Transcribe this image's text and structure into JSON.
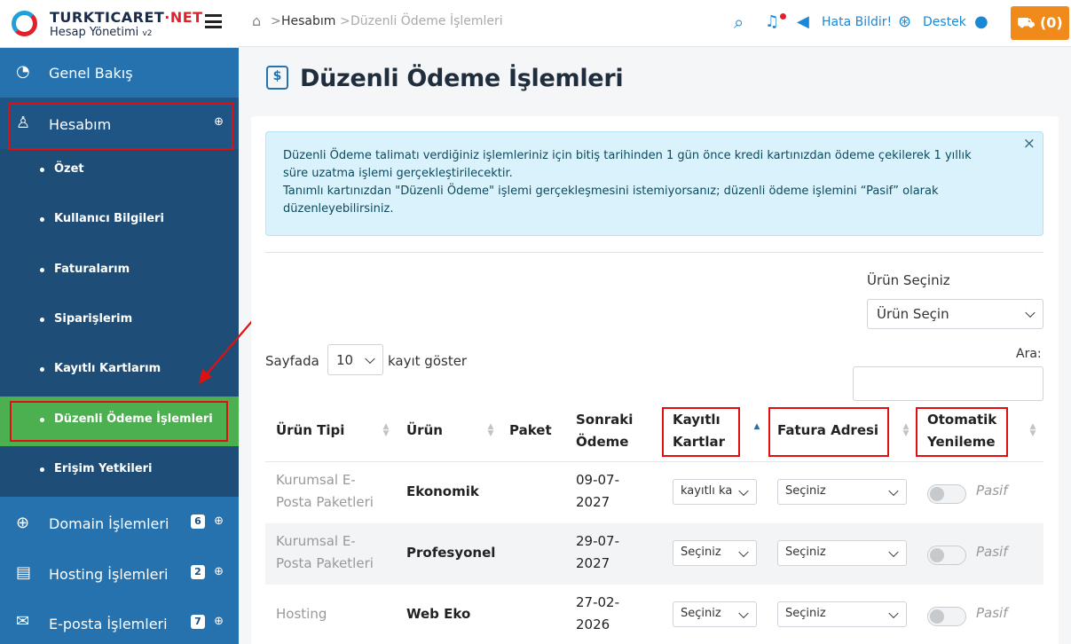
{
  "brand": {
    "title_main": "TURKTICARET",
    "title_dot": "·",
    "title_net": "NET",
    "subtitle": "Hesap Yönetimi",
    "version": "v2"
  },
  "breadcrumb": {
    "home_sep": ">",
    "item1": "Hesabım",
    "sep": ">",
    "item2": "Düzenli Ödeme İşlemleri"
  },
  "topbar": {
    "report_label": "Hata Bildir!",
    "support_label": "Destek",
    "cart_count": "(0)"
  },
  "sidebar": {
    "overview": "Genel Bakış",
    "account": "Hesabım",
    "sub_items": [
      "Özet",
      "Kullanıcı Bilgileri",
      "Faturalarım",
      "Siparişlerim",
      "Kayıtlı Kartlarım",
      "Düzenli Ödeme İşlemleri",
      "Erişim Yetkileri"
    ],
    "domain": {
      "label": "Domain İşlemleri",
      "badge": "6"
    },
    "hosting": {
      "label": "Hosting İşlemleri",
      "badge": "2"
    },
    "email": {
      "label": "E-posta İşlemleri",
      "badge": "7"
    }
  },
  "page": {
    "title": "Düzenli Ödeme İşlemleri"
  },
  "alert": {
    "line1": "Düzenli Ödeme talimatı verdiğiniz işlemleriniz için bitiş tarihinden 1 gün önce kredi kartınızdan ödeme çekilerek 1 yıllık süre uzatma işlemi gerçekleştirilecektir.",
    "line2": "Tanımlı kartınızdan \"Düzenli Ödeme\" işlemi gerçekleşmesini istemiyorsanız; düzenli ödeme işlemini “Pasif” olarak düzenleyebilirsiniz.",
    "close": "×"
  },
  "filter": {
    "label": "Ürün Seçiniz",
    "value": "Ürün Seçin"
  },
  "length": {
    "prefix": "Sayfada",
    "value": "10",
    "suffix": "kayıt göster"
  },
  "search": {
    "label": "Ara:",
    "value": ""
  },
  "table": {
    "headers": {
      "type": "Ürün Tipi",
      "product": "Ürün",
      "package": "Paket",
      "next_l1": "Sonraki",
      "next_l2": "Ödeme",
      "cards_l1": "Kayıtlı",
      "cards_l2": "Kartlar",
      "invoice": "Fatura Adresi",
      "auto_l1": "Otomatik",
      "auto_l2": "Yenileme"
    },
    "rows": [
      {
        "type_l1": "Kurumsal E-",
        "type_l2": "Posta Paketleri",
        "product": "Ekonomik",
        "date_l1": "09-07-",
        "date_l2": "2027",
        "card": "kayıtlı ka",
        "invoice": "Seçiniz",
        "status": "Pasif"
      },
      {
        "type_l1": "Kurumsal E-",
        "type_l2": "Posta Paketleri",
        "product": "Profesyonel",
        "date_l1": "29-07-",
        "date_l2": "2027",
        "card": "Seçiniz",
        "invoice": "Seçiniz",
        "status": "Pasif"
      },
      {
        "type_l1": "Hosting",
        "type_l2": "",
        "product": "Web Eko",
        "date_l1": "27-02-",
        "date_l2": "2026",
        "card": "Seçiniz",
        "invoice": "Seçiniz",
        "status": "Pasif"
      }
    ]
  },
  "colors": {
    "sidebar_dark": "#1e4e77",
    "sidebar_main": "#2572ae",
    "active_green": "#4caf50",
    "accent_blue": "#1a88d6",
    "cart_orange": "#ef8a1b",
    "highlight_red": "#e01010"
  }
}
